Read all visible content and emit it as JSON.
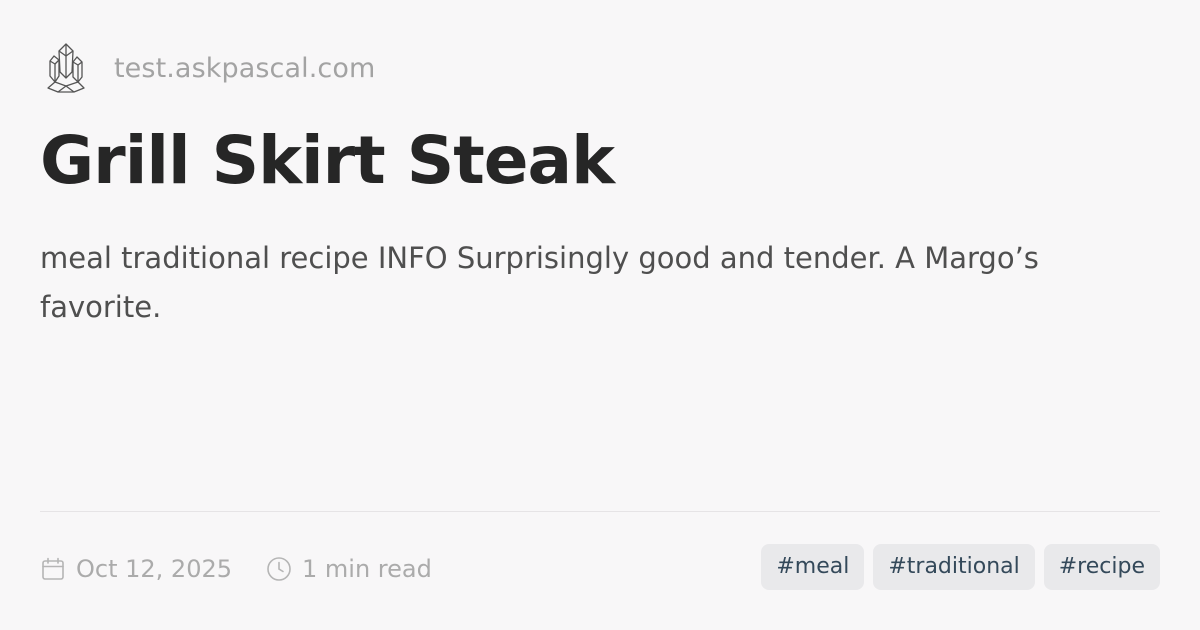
{
  "site": {
    "logo_icon": "crystal-cluster-icon",
    "name": "test.askpascal.com"
  },
  "post": {
    "title": "Grill Skirt Steak",
    "description": "meal traditional recipe INFO Surprisingly good and tender. A Margo’s favorite."
  },
  "meta": {
    "date_icon": "calendar-icon",
    "date": "Oct 12, 2025",
    "read_icon": "clock-icon",
    "read_time": "1 min read"
  },
  "tags": [
    {
      "label": "#meal"
    },
    {
      "label": "#traditional"
    },
    {
      "label": "#recipe"
    }
  ],
  "colors": {
    "background": "#f8f7f8",
    "title": "#262626",
    "muted": "#a3a3a3",
    "tag_bg": "#e9e9eb",
    "tag_text": "#34495a"
  }
}
